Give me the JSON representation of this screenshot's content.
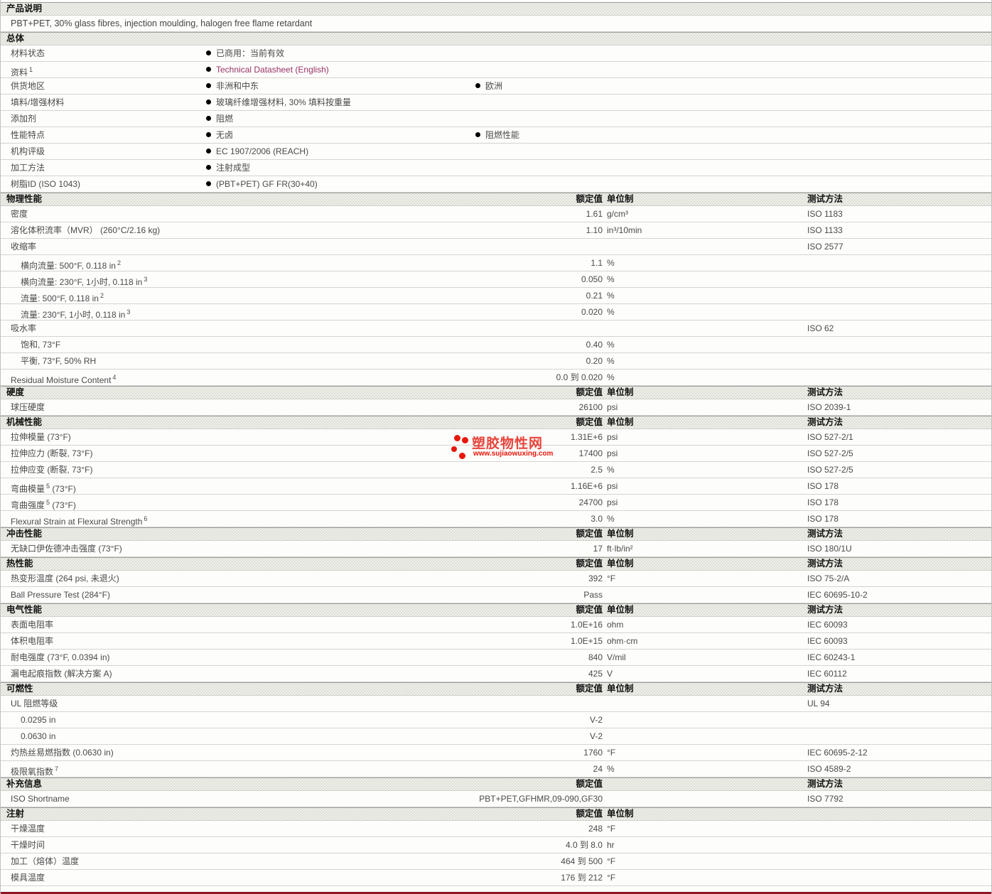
{
  "meta": {
    "link_color": "#993366",
    "bottom_rule_color": "#8e1627",
    "watermark_color": "#e8170b"
  },
  "column_headers": {
    "value": "额定值",
    "unit": "单位制",
    "method": "测试方法"
  },
  "watermark": {
    "title": "塑胶物性网",
    "url": "www.sujiaowuxing.com"
  },
  "sections": [
    {
      "title": "产品说明",
      "header_cols": [],
      "rows": [
        {
          "type": "text",
          "text": "PBT+PET, 30% glass fibres, injection moulding, halogen free flame retardant"
        }
      ]
    },
    {
      "title": "总体",
      "header_cols": [],
      "rows": [
        {
          "type": "bullets",
          "label": "材料状态",
          "bullets": [
            {
              "text": "已商用：当前有效"
            }
          ]
        },
        {
          "type": "bullets",
          "label": "资料",
          "sup": "1",
          "bullets": [
            {
              "text": "Technical Datasheet (English)",
              "link": true
            }
          ]
        },
        {
          "type": "bullets",
          "label": "供货地区",
          "bullets": [
            {
              "text": "非洲和中东"
            },
            {
              "text": "欧洲",
              "col": 2
            }
          ]
        },
        {
          "type": "bullets",
          "label": "填料/增强材料",
          "bullets": [
            {
              "text": "玻璃纤维增强材料, 30% 填料按重量"
            }
          ]
        },
        {
          "type": "bullets",
          "label": "添加剂",
          "bullets": [
            {
              "text": "阻燃"
            }
          ]
        },
        {
          "type": "bullets",
          "label": "性能特点",
          "bullets": [
            {
              "text": "无卤"
            },
            {
              "text": "阻燃性能",
              "col": 2
            }
          ]
        },
        {
          "type": "bullets",
          "label": "机构评级",
          "bullets": [
            {
              "text": "EC 1907/2006 (REACH)"
            }
          ]
        },
        {
          "type": "bullets",
          "label": "加工方法",
          "bullets": [
            {
              "text": "注射成型"
            }
          ]
        },
        {
          "type": "bullets",
          "label": "树脂ID (ISO 1043)",
          "bullets": [
            {
              "text": "(PBT+PET) GF FR(30+40)"
            }
          ]
        }
      ]
    },
    {
      "title": "物理性能",
      "header_cols": [
        "value",
        "unit",
        "method"
      ],
      "rows": [
        {
          "type": "prop",
          "label": "密度",
          "value": "1.61",
          "unit": "g/cm³",
          "method": "ISO 1183"
        },
        {
          "type": "prop",
          "label": "溶化体积流率（MVR）  (260°C/2.16 kg)",
          "value": "1.10",
          "unit": "in³/10min",
          "method": "ISO 1133"
        },
        {
          "type": "prop",
          "label": "收缩率",
          "method": "ISO 2577"
        },
        {
          "type": "prop",
          "label": "横向流量: 500°F, 0.118 in",
          "sup": "2",
          "indent": 1,
          "value": "1.1",
          "unit": "%"
        },
        {
          "type": "prop",
          "label": "横向流量: 230°F, 1小时, 0.118 in",
          "sup": "3",
          "indent": 1,
          "value": "0.050",
          "unit": "%"
        },
        {
          "type": "prop",
          "label": "流量: 500°F, 0.118 in",
          "sup": "2",
          "indent": 1,
          "value": "0.21",
          "unit": "%"
        },
        {
          "type": "prop",
          "label": "流量: 230°F, 1小时, 0.118 in",
          "sup": "3",
          "indent": 1,
          "value": "0.020",
          "unit": "%"
        },
        {
          "type": "prop",
          "label": "吸水率",
          "method": "ISO 62"
        },
        {
          "type": "prop",
          "label": "饱和, 73°F",
          "indent": 1,
          "value": "0.40",
          "unit": "%"
        },
        {
          "type": "prop",
          "label": "平衡, 73°F, 50% RH",
          "indent": 1,
          "value": "0.20",
          "unit": "%"
        },
        {
          "type": "prop",
          "label": "Residual Moisture Content",
          "sup": "4",
          "value": "0.0 到  0.020",
          "unit": "%"
        }
      ]
    },
    {
      "title": "硬度",
      "header_cols": [
        "value",
        "unit",
        "method"
      ],
      "rows": [
        {
          "type": "prop",
          "label": "球压硬度",
          "value": "26100",
          "unit": "psi",
          "method": "ISO 2039-1"
        }
      ]
    },
    {
      "title": "机械性能",
      "header_cols": [
        "value",
        "unit",
        "method"
      ],
      "rows": [
        {
          "type": "prop",
          "label": "拉伸模量 (73°F)",
          "value": "1.31E+6",
          "unit": "psi",
          "method": "ISO 527-2/1"
        },
        {
          "type": "prop",
          "label": "拉伸应力 (断裂, 73°F)",
          "value": "17400",
          "unit": "psi",
          "method": "ISO 527-2/5"
        },
        {
          "type": "prop",
          "label": "拉伸应变 (断裂, 73°F)",
          "value": "2.5",
          "unit": "%",
          "method": "ISO 527-2/5"
        },
        {
          "type": "prop",
          "label": "弯曲模量",
          "sup": "5",
          "tail": " (73°F)",
          "value": "1.16E+6",
          "unit": "psi",
          "method": "ISO 178"
        },
        {
          "type": "prop",
          "label": "弯曲强度",
          "sup": "5",
          "tail": " (73°F)",
          "value": "24700",
          "unit": "psi",
          "method": "ISO 178"
        },
        {
          "type": "prop",
          "label": "Flexural Strain at Flexural Strength",
          "sup": "6",
          "value": "3.0",
          "unit": "%",
          "method": "ISO 178"
        }
      ]
    },
    {
      "title": "冲击性能",
      "header_cols": [
        "value",
        "unit",
        "method"
      ],
      "rows": [
        {
          "type": "prop",
          "label": "无缺口伊佐德冲击强度  (73°F)",
          "value": "17",
          "unit": "ft·lb/in²",
          "method": "ISO 180/1U"
        }
      ]
    },
    {
      "title": "热性能",
      "header_cols": [
        "value",
        "unit",
        "method"
      ],
      "rows": [
        {
          "type": "prop",
          "label": "热变形温度  (264 psi, 未退火)",
          "value": "392",
          "unit": "°F",
          "method": "ISO 75-2/A"
        },
        {
          "type": "prop",
          "label": "Ball Pressure Test (284°F)",
          "value": "Pass",
          "method": "IEC 60695-10-2"
        }
      ]
    },
    {
      "title": "电气性能",
      "header_cols": [
        "value",
        "unit",
        "method"
      ],
      "rows": [
        {
          "type": "prop",
          "label": "表面电阻率",
          "value": "1.0E+16",
          "unit": "ohm",
          "method": "IEC 60093"
        },
        {
          "type": "prop",
          "label": "体积电阻率",
          "value": "1.0E+15",
          "unit": "ohm·cm",
          "method": "IEC 60093"
        },
        {
          "type": "prop",
          "label": "耐电强度  (73°F, 0.0394 in)",
          "value": "840",
          "unit": "V/mil",
          "method": "IEC 60243-1"
        },
        {
          "type": "prop",
          "label": "漏电起痕指数  (解决方案  A)",
          "value": "425",
          "unit": "V",
          "method": "IEC 60112"
        }
      ]
    },
    {
      "title": "可燃性",
      "header_cols": [
        "value",
        "unit",
        "method"
      ],
      "rows": [
        {
          "type": "prop",
          "label": "UL 阻燃等级",
          "method": "UL 94"
        },
        {
          "type": "prop",
          "label": "0.0295 in",
          "indent": 1,
          "value": "V-2"
        },
        {
          "type": "prop",
          "label": "0.0630 in",
          "indent": 1,
          "value": "V-2"
        },
        {
          "type": "prop",
          "label": "灼热丝易燃指数  (0.0630 in)",
          "value": "1760",
          "unit": "°F",
          "method": "IEC 60695-2-12"
        },
        {
          "type": "prop",
          "label": "极限氧指数",
          "sup": "7",
          "value": "24",
          "unit": "%",
          "method": "ISO 4589-2"
        }
      ]
    },
    {
      "title": "补充信息",
      "header_cols": [
        "value",
        "method"
      ],
      "rows": [
        {
          "type": "prop",
          "label": "ISO Shortname",
          "value": "PBT+PET,GFHMR,09-090,GF30",
          "method": "ISO 7792"
        }
      ]
    },
    {
      "title": "注射",
      "header_cols": [
        "value",
        "unit"
      ],
      "rows": [
        {
          "type": "prop",
          "label": "干燥温度",
          "value": "248",
          "unit": "°F"
        },
        {
          "type": "prop",
          "label": "干燥时间",
          "value": "4.0 到  8.0",
          "unit": "hr"
        },
        {
          "type": "prop",
          "label": "加工（熔体）温度",
          "value": "464 到  500",
          "unit": "°F"
        },
        {
          "type": "prop",
          "label": "模具温度",
          "value": "176 到  212",
          "unit": "°F"
        }
      ]
    }
  ]
}
